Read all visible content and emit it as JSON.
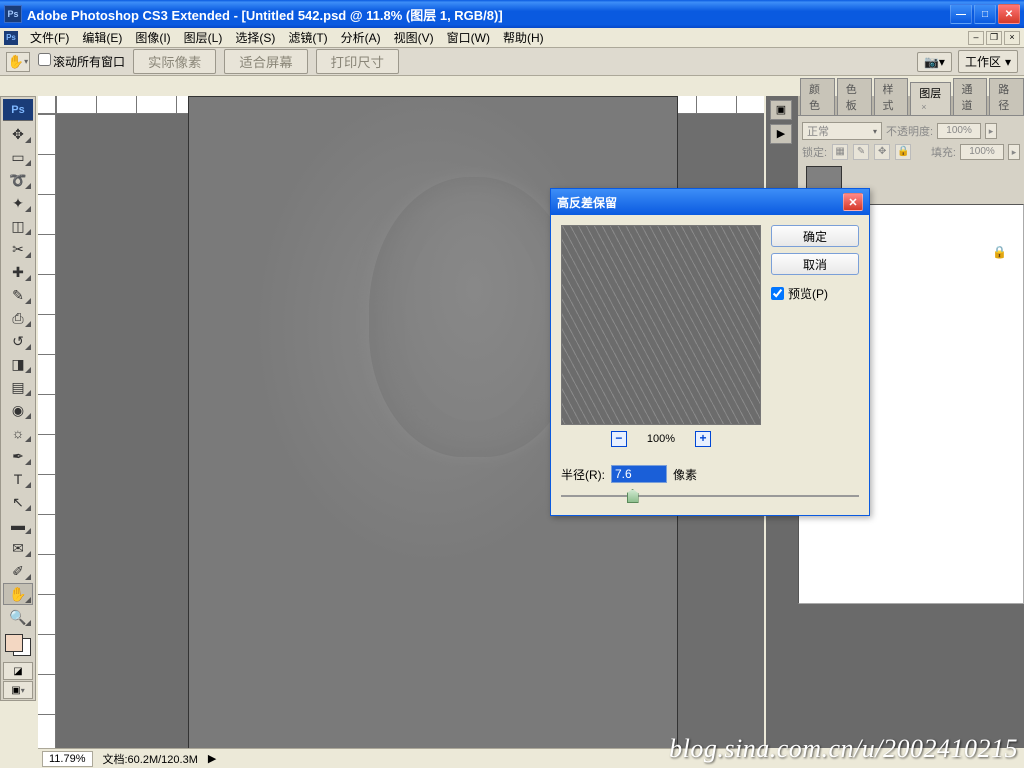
{
  "title": "Adobe Photoshop CS3 Extended - [Untitled 542.psd @ 11.8% (图层 1, RGB/8)]",
  "menu": [
    "文件(F)",
    "编辑(E)",
    "图像(I)",
    "图层(L)",
    "选择(S)",
    "滤镜(T)",
    "分析(A)",
    "视图(V)",
    "窗口(W)",
    "帮助(H)"
  ],
  "options": {
    "scroll_all": "滚动所有窗口",
    "actual_px": "实际像素",
    "fit_screen": "适合屏幕",
    "print_size": "打印尺寸",
    "workspace": "工作区"
  },
  "tools": [
    {
      "n": "move",
      "g": "✥"
    },
    {
      "n": "marquee",
      "g": "▭"
    },
    {
      "n": "lasso",
      "g": "➰"
    },
    {
      "n": "wand",
      "g": "✦"
    },
    {
      "n": "crop",
      "g": "◫"
    },
    {
      "n": "slice",
      "g": "✂"
    },
    {
      "n": "heal",
      "g": "✚"
    },
    {
      "n": "brush",
      "g": "✎"
    },
    {
      "n": "stamp",
      "g": "⎙"
    },
    {
      "n": "history",
      "g": "↺"
    },
    {
      "n": "eraser",
      "g": "◨"
    },
    {
      "n": "gradient",
      "g": "▤"
    },
    {
      "n": "blur",
      "g": "◉"
    },
    {
      "n": "dodge",
      "g": "☼"
    },
    {
      "n": "pen",
      "g": "✒"
    },
    {
      "n": "type",
      "g": "T"
    },
    {
      "n": "path",
      "g": "↖"
    },
    {
      "n": "shape",
      "g": "▬"
    },
    {
      "n": "notes",
      "g": "✉"
    },
    {
      "n": "eyedrop",
      "g": "✐"
    },
    {
      "n": "hand",
      "g": "✋"
    },
    {
      "n": "zoom",
      "g": "🔍"
    }
  ],
  "panels": {
    "tabs": [
      {
        "label": "颜色",
        "active": false
      },
      {
        "label": "色板",
        "active": false
      },
      {
        "label": "样式",
        "active": false
      },
      {
        "label": "图层",
        "active": true
      },
      {
        "label": "通道",
        "active": false
      },
      {
        "label": "路径",
        "active": false
      }
    ],
    "blend_mode": "正常",
    "opacity_label": "不透明度:",
    "opacity_value": "100%",
    "lock_label": "锁定:",
    "fill_label": "填充:",
    "fill_value": "100%"
  },
  "dialog": {
    "title": "高反差保留",
    "ok": "确定",
    "cancel": "取消",
    "preview": "预览(P)",
    "zoom": "100%",
    "radius_label": "半径(R):",
    "radius_value": "7.6",
    "radius_unit": "像素"
  },
  "status": {
    "zoom": "11.79%",
    "doc": "文档:60.2M/120.3M"
  },
  "watermark": "blog.sina.com.cn/u/2002410215"
}
